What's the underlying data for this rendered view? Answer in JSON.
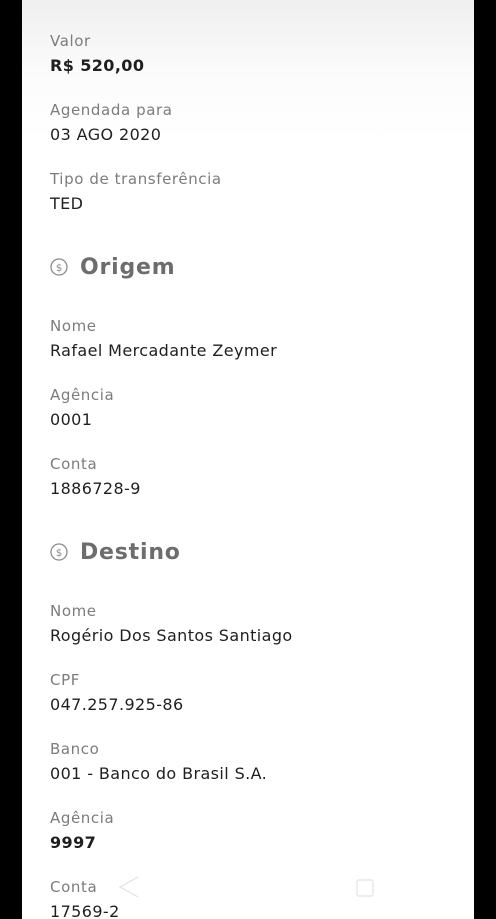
{
  "transfer": {
    "amount_label": "Valor",
    "amount_value": "R$ 520,00",
    "scheduled_label": "Agendada para",
    "scheduled_value": "03 AGO 2020",
    "type_label": "Tipo de transferência",
    "type_value": "TED"
  },
  "origin": {
    "heading": "Origem",
    "icon": "dollar-coin-icon",
    "name_label": "Nome",
    "name_value": "Rafael Mercadante Zeymer",
    "branch_label": "Agência",
    "branch_value": "0001",
    "account_label": "Conta",
    "account_value": "1886728-9"
  },
  "destination": {
    "heading": "Destino",
    "icon": "dollar-coin-icon",
    "name_label": "Nome",
    "name_value": "Rogério Dos Santos Santiago",
    "cpf_label": "CPF",
    "cpf_value": "047.257.925-86",
    "bank_label": "Banco",
    "bank_value": "001 - Banco do Brasil S.A.",
    "branch_label": "Agência",
    "branch_value": "9997",
    "account_label": "Conta",
    "account_value": "17569-2"
  },
  "colors": {
    "background": "#ffffff",
    "label": "#7c7c7c",
    "value": "#1f1f1f",
    "heading": "#6d6d6d",
    "outer_frame": "#000000"
  }
}
